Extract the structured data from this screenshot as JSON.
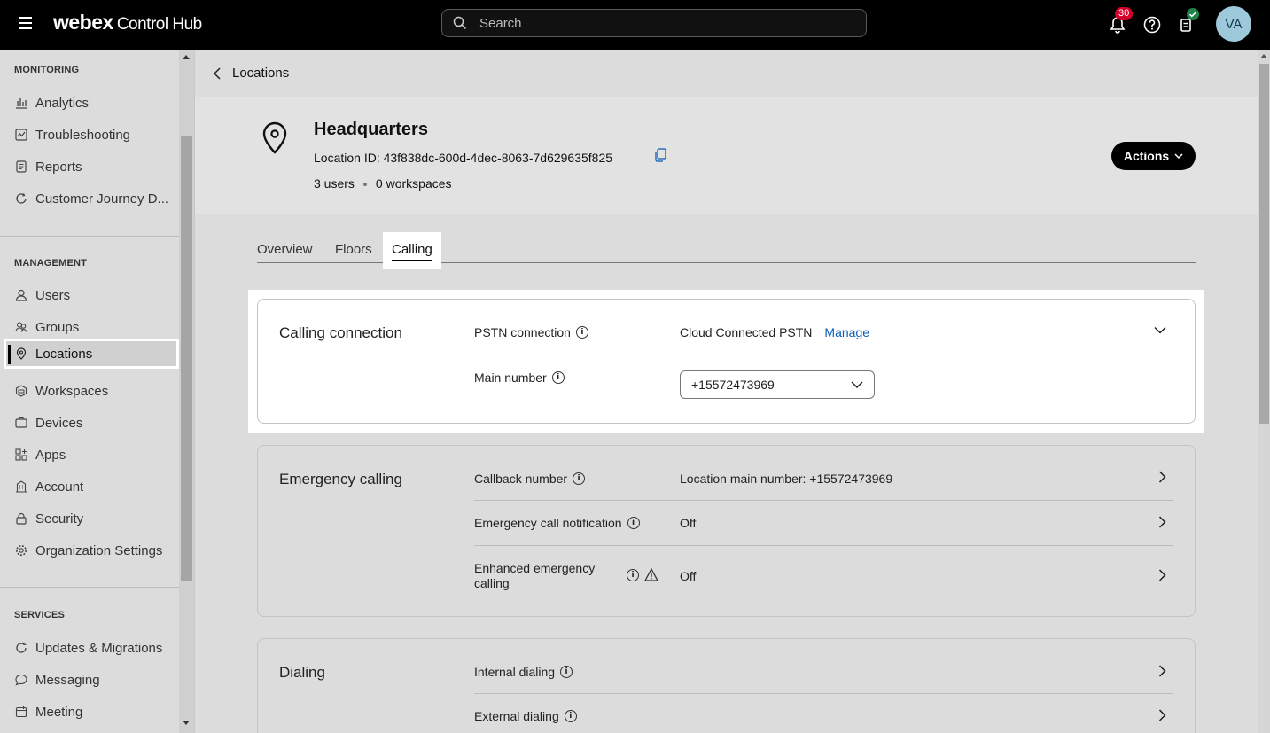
{
  "app": {
    "brand_bold": "webex",
    "brand_sub": "Control Hub",
    "search_placeholder": "Search",
    "notification_count": "30",
    "avatar_initials": "VA"
  },
  "sidebar": {
    "sections": [
      {
        "heading": "MONITORING",
        "items": [
          "Analytics",
          "Troubleshooting",
          "Reports",
          "Customer Journey D..."
        ]
      },
      {
        "heading": "MANAGEMENT",
        "items": [
          "Users",
          "Groups",
          "Locations",
          "Workspaces",
          "Devices",
          "Apps",
          "Account",
          "Security",
          "Organization Settings"
        ]
      },
      {
        "heading": "SERVICES",
        "items": [
          "Updates & Migrations",
          "Messaging",
          "Meeting"
        ]
      }
    ],
    "active_item": "Locations"
  },
  "breadcrumb": {
    "back_label": "Locations"
  },
  "location": {
    "name": "Headquarters",
    "id_text": "Location ID: 43f838dc-600d-4dec-8063-7d629635f825",
    "users": "3 users",
    "workspaces": "0 workspaces",
    "actions_label": "Actions"
  },
  "tabs": [
    {
      "label": "Overview",
      "active": false
    },
    {
      "label": "Floors",
      "active": false
    },
    {
      "label": "Calling",
      "active": true
    }
  ],
  "cards": {
    "calling_connection": {
      "title": "Calling connection",
      "pstn_label": "PSTN connection",
      "pstn_value": "Cloud Connected PSTN",
      "manage_label": "Manage",
      "main_number_label": "Main number",
      "main_number_value": "+15572473969"
    },
    "emergency": {
      "title": "Emergency calling",
      "callback_label": "Callback number",
      "callback_value": "Location main number: +15572473969",
      "notification_label": "Emergency call notification",
      "notification_value": "Off",
      "enhanced_label_1": "Enhanced emergency",
      "enhanced_label_2": "calling",
      "enhanced_value": "Off"
    },
    "dialing": {
      "title": "Dialing",
      "internal_label": "Internal dialing",
      "external_label": "External dialing"
    }
  }
}
